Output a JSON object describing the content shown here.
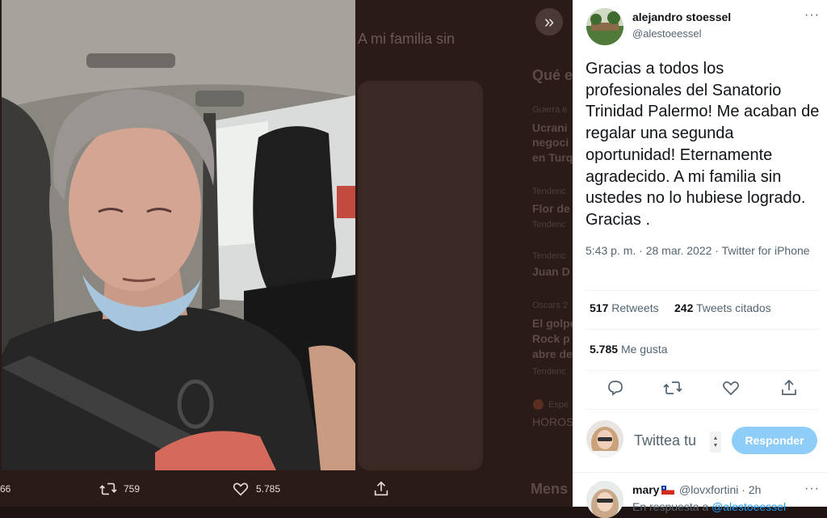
{
  "background_page": {
    "tweet_fragment": "A mi familia sin",
    "sidebar_title": "Qué e",
    "trend_lines": [
      "Ucrani",
      "negoci",
      "en Turq",
      "Flor de",
      "Juan D",
      "El golpe",
      "Rock p",
      "abre de",
      "HOROS"
    ],
    "trend_meta": [
      "Guerra e",
      "Tendenc",
      "Tendenc",
      "Tendenc",
      "Oscars 2",
      "Tendenc",
      "Espe"
    ],
    "messages_label": "Mens"
  },
  "media_actions": {
    "reply_count": "66",
    "retweet_count": "759",
    "like_count": "5.785"
  },
  "tweet": {
    "author_name": "alejandro stoessel",
    "author_handle": "@alestoeessel",
    "text": "Gracias a todos los profesionales del Sanatorio Trinidad Palermo! Me acaban de regalar una segunda oportunidad! Eternamente agradecido. A mi familia sin ustedes no lo hubiese logrado.  Gracias .",
    "timestamp": "5:43 p. m. · 28 mar. 2022 · Twitter for iPhone",
    "retweets_count": "517",
    "retweets_label": "Retweets",
    "quotes_count": "242",
    "quotes_label": "Tweets citados",
    "likes_count": "5.785",
    "likes_label": "Me gusta"
  },
  "reply_box": {
    "placeholder": "Twittea tu",
    "button_label": "Responder"
  },
  "first_reply": {
    "name": "mary",
    "handle_time": "@lovxfortini · 2h",
    "in_reply_prefix": "En respuesta a",
    "in_reply_handle": "@alestoeessel"
  },
  "icons": {
    "expand": "double-chevron-right-icon",
    "reply": "speech-bubble-icon",
    "retweet": "retweet-icon",
    "like": "heart-icon",
    "share": "share-icon",
    "more": "more-dots-icon",
    "flag": "chile-flag-icon"
  },
  "colors": {
    "accent": "#1d9bf0",
    "reply_button_disabled": "#8ecdf8",
    "text_primary": "#0f1419",
    "text_secondary": "#536471",
    "overlay": "#2a1a18"
  }
}
